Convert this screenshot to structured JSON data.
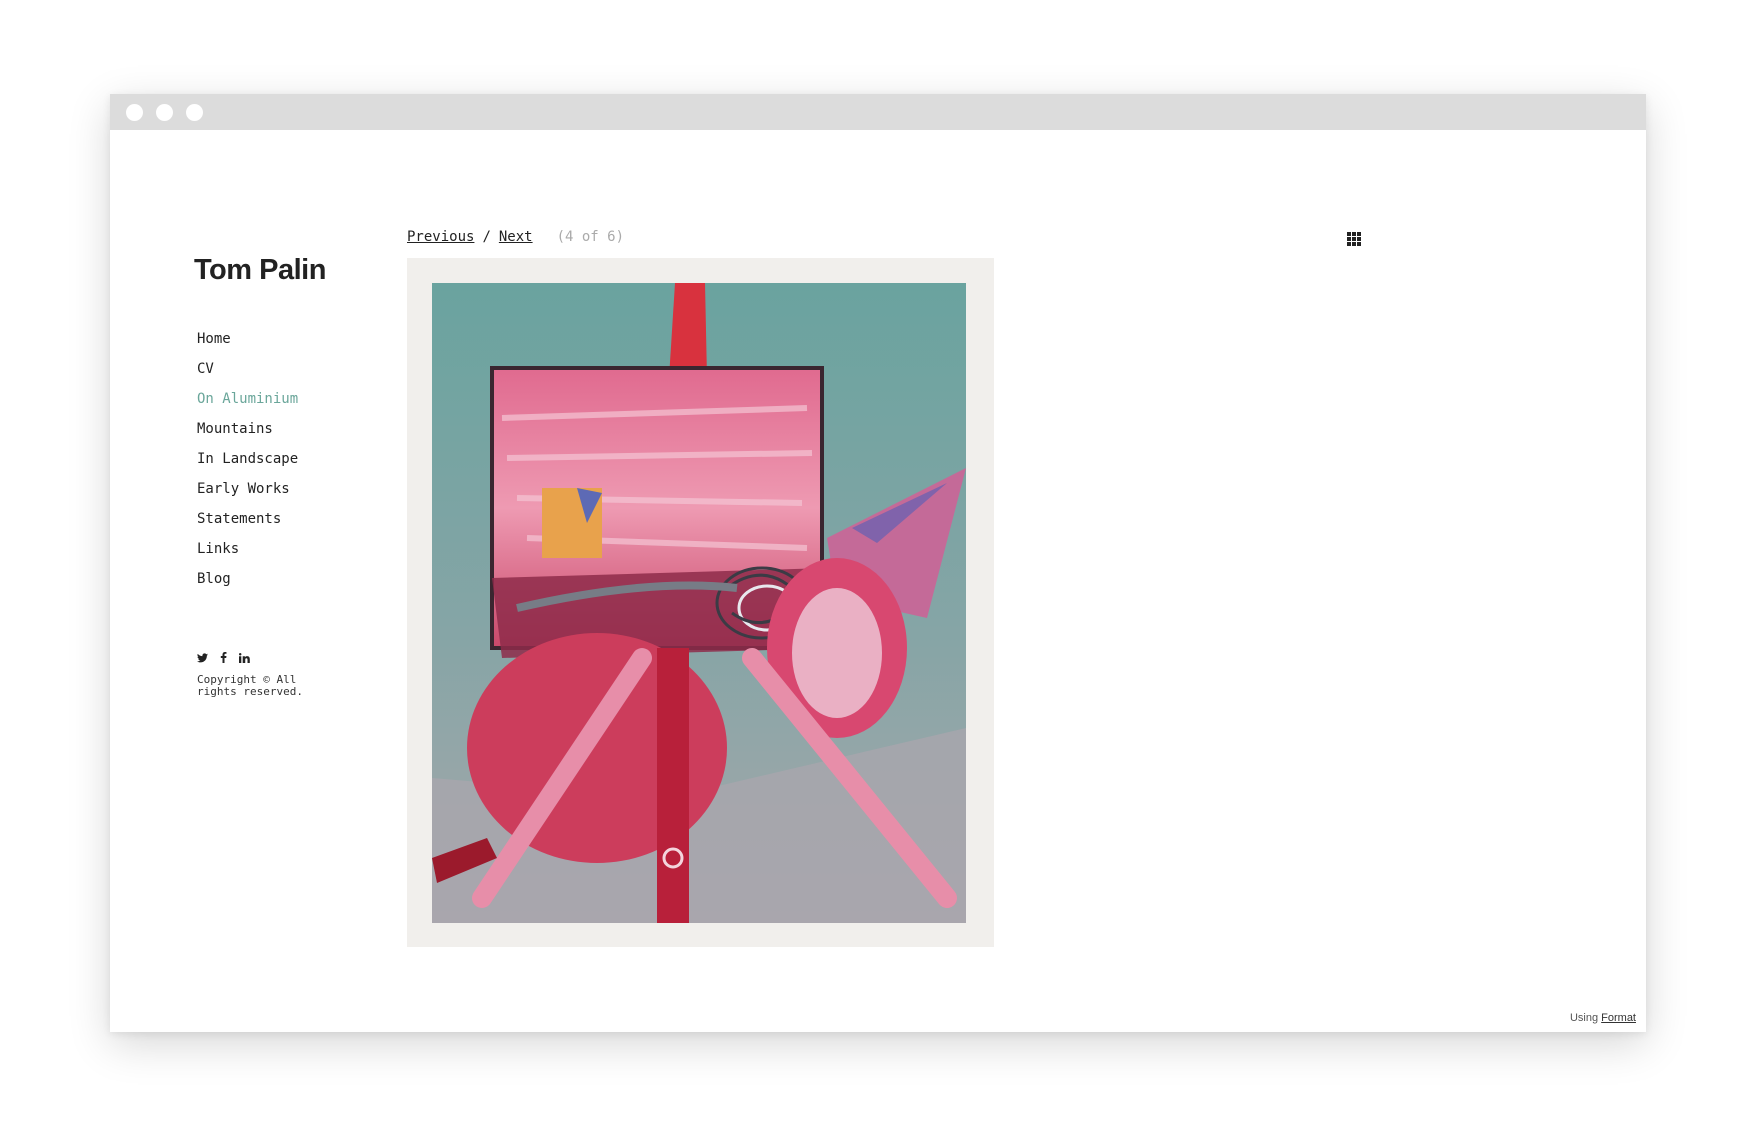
{
  "site": {
    "title": "Tom Palin"
  },
  "nav": {
    "items": [
      {
        "label": "Home"
      },
      {
        "label": "CV"
      },
      {
        "label": "On Aluminium",
        "active": true
      },
      {
        "label": "Mountains"
      },
      {
        "label": "In Landscape"
      },
      {
        "label": "Early Works"
      },
      {
        "label": "Statements"
      },
      {
        "label": "Links"
      },
      {
        "label": "Blog"
      }
    ]
  },
  "social": {
    "twitter": "twitter-icon",
    "facebook": "facebook-icon",
    "linkedin": "linkedin-icon"
  },
  "footer": {
    "copyright": "Copyright © All rights reserved.",
    "credit_prefix": "Using",
    "credit_link": "Format"
  },
  "pager": {
    "previous": "Previous",
    "separator": "/",
    "next": "Next",
    "count": "(4 of 6)"
  },
  "colors": {
    "active_nav": "#6aa69a",
    "text": "#222222",
    "titlebar": "#dcdcdc"
  }
}
